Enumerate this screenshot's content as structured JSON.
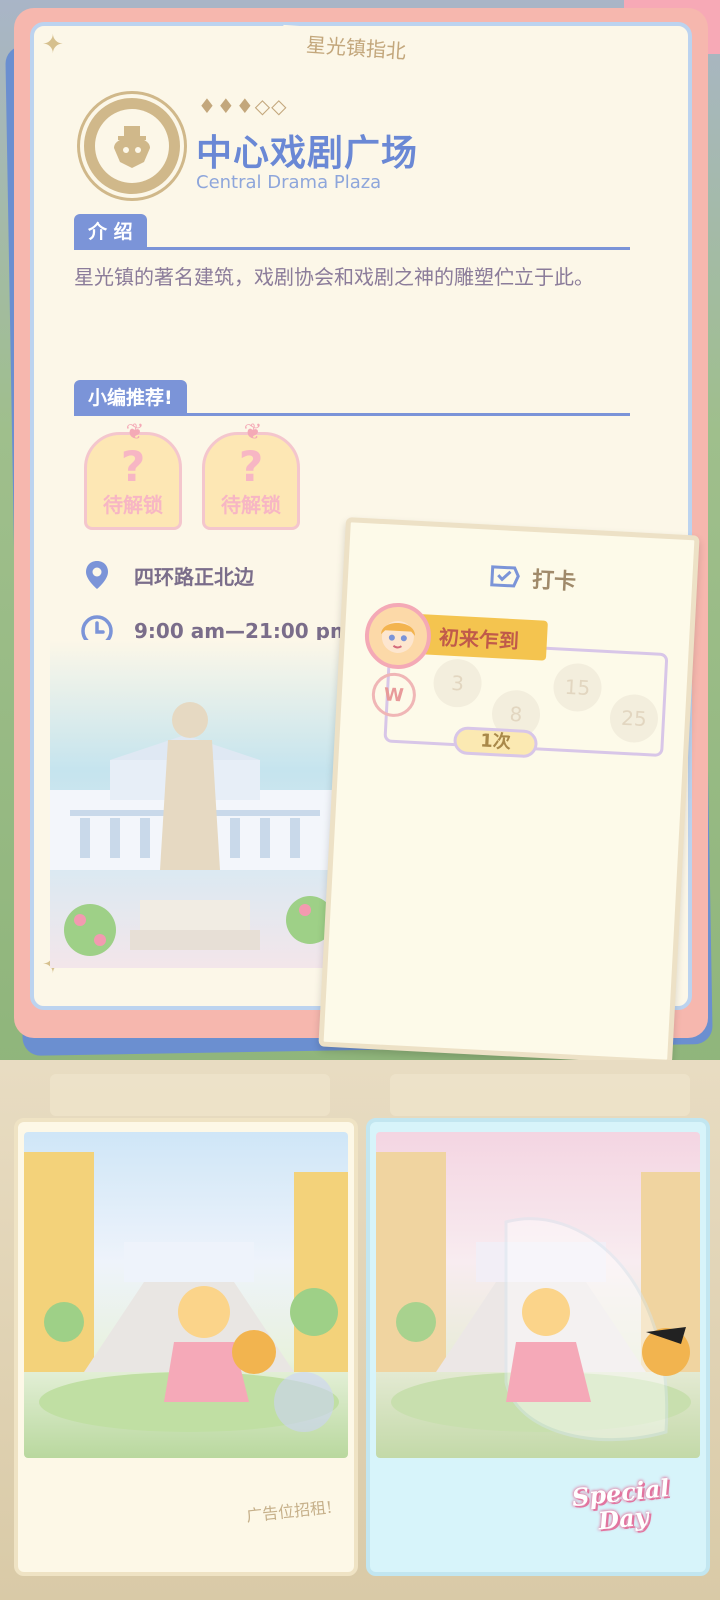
{
  "guide_tag": "星光镇指北",
  "location": {
    "rating_stars": "♦♦♦◇◇",
    "name_cn": "中心戏剧广场",
    "name_en": "Central Drama Plaza"
  },
  "intro": {
    "label": "介 绍",
    "text": "星光镇的著名建筑，戏剧协会和戏剧之神的雕塑伫立于此。"
  },
  "recommend": {
    "label": "小编推荐!",
    "items": [
      {
        "mark": "?",
        "label": "待解锁"
      },
      {
        "mark": "?",
        "label": "待解锁"
      }
    ]
  },
  "address": "四环路正北边",
  "hours": "9:00 am—21:00 pm",
  "checkin": {
    "title": "打卡",
    "badge": "初来乍到",
    "milestones": [
      "3",
      "8",
      "15",
      "25"
    ],
    "count": "1次"
  },
  "photos": {
    "left_caption": "广告位招租!",
    "right_caption_line1": "Special",
    "right_caption_line2": "Day"
  },
  "colors": {
    "accent_blue": "#6a88d5",
    "card_pink": "#f6b7ae",
    "gold": "#c3a77c"
  }
}
